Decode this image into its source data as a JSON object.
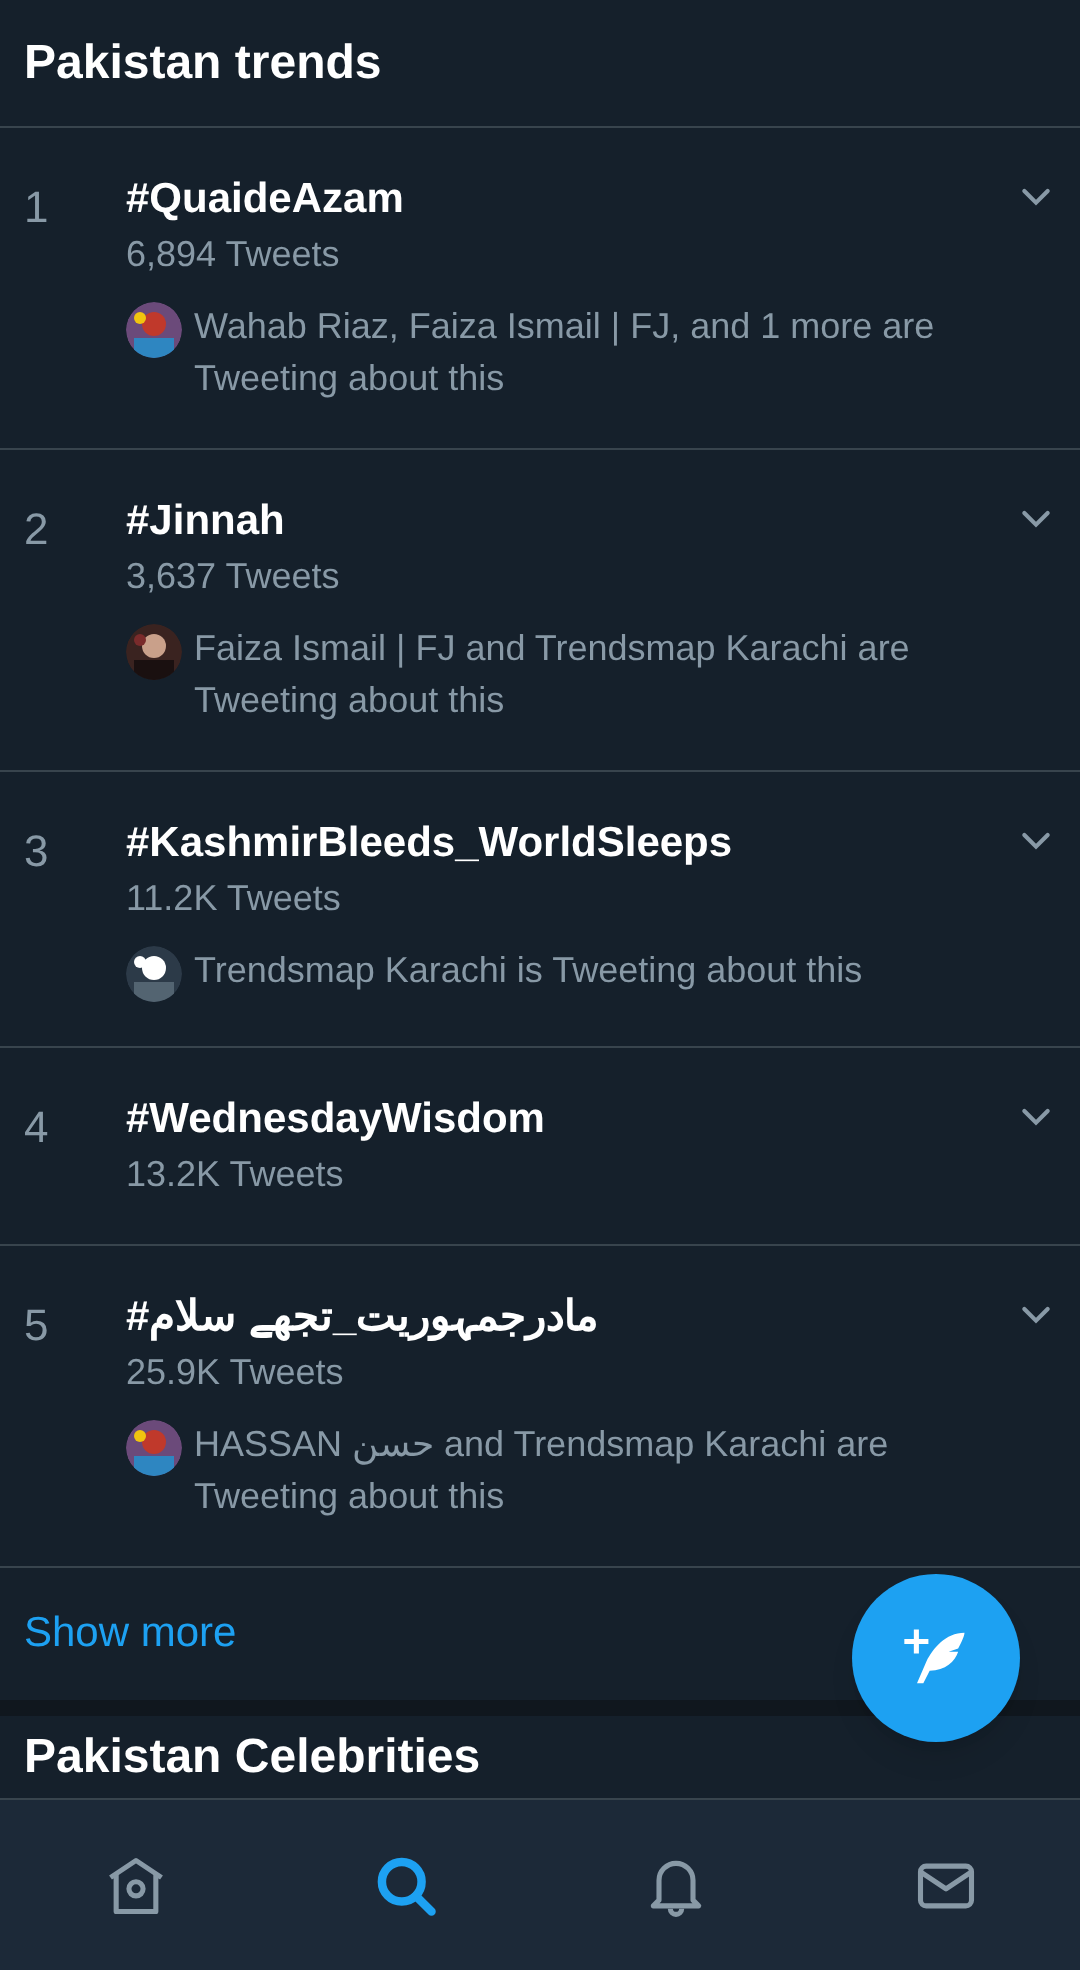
{
  "header": {
    "title": "Pakistan trends"
  },
  "trends": [
    {
      "rank": "1",
      "name": "#QuaideAzam",
      "count": "6,894 Tweets",
      "context": "Wahab Riaz, Faiza Ismail | FJ, and 1 more are Tweeting about this"
    },
    {
      "rank": "2",
      "name": "#Jinnah",
      "count": "3,637 Tweets",
      "context": "Faiza Ismail | FJ and Trendsmap Karachi are Tweeting about this"
    },
    {
      "rank": "3",
      "name": "#KashmirBleeds_WorldSleeps",
      "count": "11.2K Tweets",
      "context": "Trendsmap Karachi is Tweeting about this"
    },
    {
      "rank": "4",
      "name": "#WednesdayWisdom",
      "count": "13.2K Tweets"
    },
    {
      "rank": "5",
      "name": "#مادرجمہوریت_تجھے سلام",
      "count": "25.9K Tweets",
      "context": "HASSAN حسن and Trendsmap Karachi are Tweeting about this"
    }
  ],
  "show_more": "Show more",
  "next_section": {
    "title": "Pakistan Celebrities"
  },
  "nav": [
    {
      "kind": "home",
      "selected": false
    },
    {
      "kind": "search",
      "selected": true
    },
    {
      "kind": "notifications",
      "selected": false
    },
    {
      "kind": "messages",
      "selected": false
    }
  ]
}
